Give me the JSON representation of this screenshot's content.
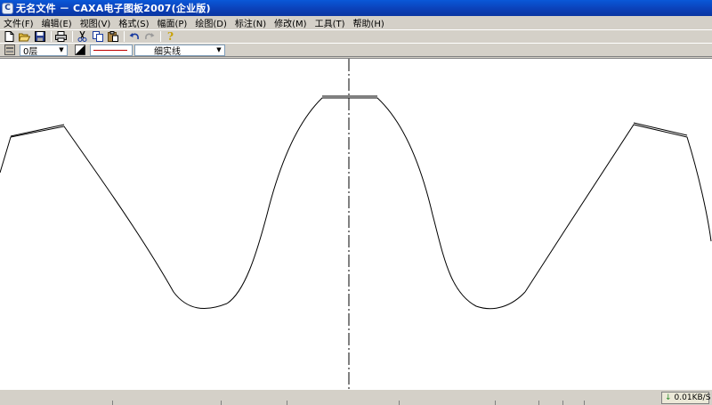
{
  "window": {
    "title": "无名文件 － CAXA电子图板2007(企业版)",
    "app_icon_glyph": "C"
  },
  "menu": [
    {
      "label": "文件(F)"
    },
    {
      "label": "编辑(E)"
    },
    {
      "label": "视图(V)"
    },
    {
      "label": "格式(S)"
    },
    {
      "label": "幅面(P)"
    },
    {
      "label": "绘图(D)"
    },
    {
      "label": "标注(N)"
    },
    {
      "label": "修改(M)"
    },
    {
      "label": "工具(T)"
    },
    {
      "label": "帮助(H)"
    }
  ],
  "toolbar": {
    "icons": [
      "new-file-icon",
      "open-folder-icon",
      "save-icon",
      "print-icon",
      "cut-icon",
      "copy-icon",
      "paste-icon",
      "undo-icon",
      "redo-icon",
      "help-icon"
    ],
    "help_glyph": "?"
  },
  "properties": {
    "layer": "0层",
    "linetype": "细实线",
    "line_color": "#c00000"
  },
  "status": {
    "net_speed": "0.01KB/S"
  },
  "colors": {
    "title_bar": "#0b3fb6",
    "canvas": "#ffffff",
    "stroke": "#000000"
  }
}
